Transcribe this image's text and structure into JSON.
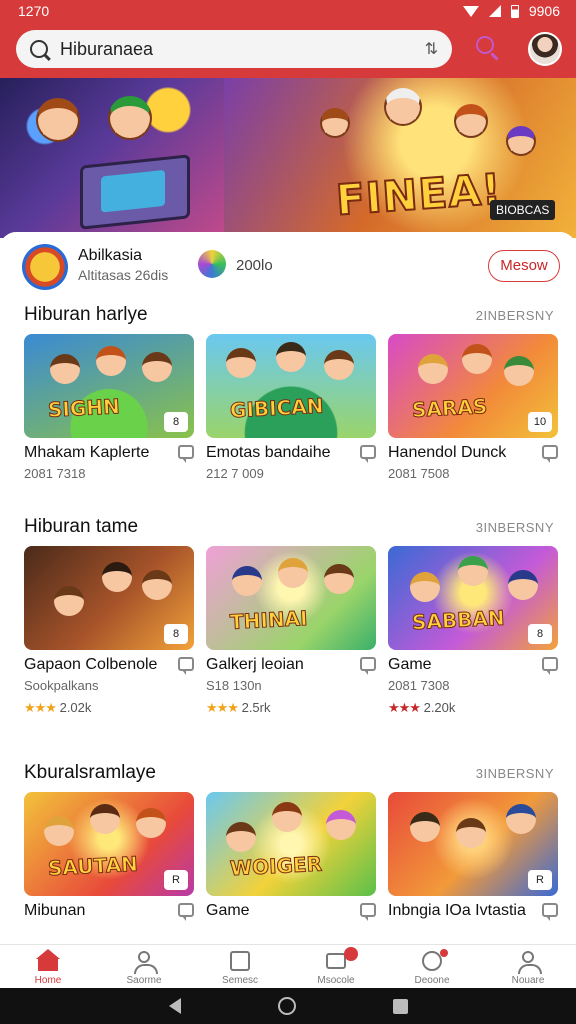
{
  "status_bar": {
    "time": "1270",
    "battery": "9906"
  },
  "search": {
    "value": "Hiburanaea",
    "placeholder": ""
  },
  "banner": {
    "title": "FINEA!",
    "tag": "BIOBCAS"
  },
  "featured_app": {
    "name": "Abilkasia",
    "subtitle": "Altitasas 26dis",
    "count": "200lo",
    "button": "Mesow"
  },
  "sections": [
    {
      "title": "Hiburan harlye",
      "more": "2INBERSNY",
      "cards": [
        {
          "title": "Mhakam Kaplerte",
          "meta": "2081 7318",
          "badge": "8",
          "art": "SIGHN",
          "rating": ""
        },
        {
          "title": "Emotas bandaihe",
          "meta": "212 7 009",
          "badge": "",
          "art": "GIBICAN",
          "rating": ""
        },
        {
          "title": "Hanendol Dunck",
          "meta": "2081 7508",
          "badge": "10",
          "art": "SARAS",
          "rating": ""
        }
      ]
    },
    {
      "title": "Hiburan tame",
      "more": "3INBERSNY",
      "cards": [
        {
          "title": "Gapaon Colbenole",
          "meta": "Sookpalkans",
          "badge": "8",
          "art": "",
          "rating": "2.02k"
        },
        {
          "title": "Galkerj leoian",
          "meta": "S18 130n",
          "badge": "",
          "art": "THINAI",
          "rating": "2.5rk"
        },
        {
          "title": "Game",
          "meta": "2081 7308",
          "badge": "8",
          "art": "SABBAN",
          "rating": "2.20k"
        }
      ]
    },
    {
      "title": "Kburalsramlaye",
      "more": "3INBERSNY",
      "cards": [
        {
          "title": "Mibunan",
          "meta": "",
          "badge": "R",
          "art": "SAUTAN",
          "rating": ""
        },
        {
          "title": "Game",
          "meta": "",
          "badge": "",
          "art": "WOIGER",
          "rating": ""
        },
        {
          "title": "Inbngia IOa Ivtastia",
          "meta": "",
          "badge": "R",
          "art": "",
          "rating": ""
        }
      ]
    }
  ],
  "bottom_nav": [
    {
      "label": "Home",
      "icon": "home-icon",
      "active": true
    },
    {
      "label": "Saorme",
      "icon": "user-icon",
      "active": false
    },
    {
      "label": "Semesc",
      "icon": "screen-icon",
      "active": false
    },
    {
      "label": "Msocole",
      "icon": "message-icon",
      "active": false,
      "badge": ""
    },
    {
      "label": "Deoone",
      "icon": "clock-icon",
      "active": false,
      "badge": ""
    },
    {
      "label": "Nouare",
      "icon": "profile-icon",
      "active": false
    }
  ],
  "colors": {
    "accent": "#d63a3a",
    "star": "#f2a31a"
  }
}
